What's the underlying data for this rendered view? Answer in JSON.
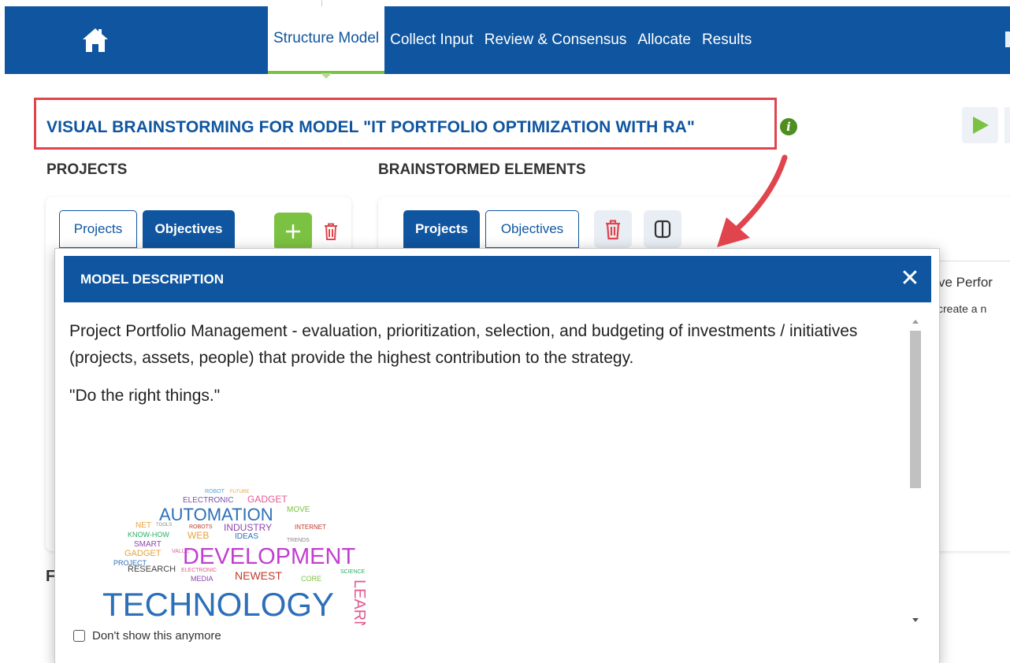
{
  "nav": {
    "home_icon": "home-icon",
    "tabs": [
      {
        "label": "Structure Model",
        "active": true
      },
      {
        "label": "Collect Input",
        "active": false
      },
      {
        "label": "Review & Consensus",
        "active": false
      },
      {
        "label": "Allocate",
        "active": false
      },
      {
        "label": "Results",
        "active": false
      }
    ]
  },
  "page": {
    "title": "VISUAL BRAINSTORMING FOR MODEL \"IT PORTFOLIO OPTIMIZATION WITH RA\"",
    "info_icon": "i"
  },
  "left_panel": {
    "heading": "PROJECTS",
    "tab_projects": "Projects",
    "tab_objectives": "Objectives",
    "add_label": "+"
  },
  "right_panel": {
    "heading": "BRAINSTORMED ELEMENTS",
    "tab_projects": "Projects",
    "tab_objectives": "Objectives",
    "peek_title": "ve Perfor",
    "peek_subtitle": "create a n"
  },
  "modal": {
    "title": "MODEL DESCRIPTION",
    "close_label": "✕",
    "paragraph_1": "Project Portfolio Management - evaluation, prioritization, selection, and budgeting of investments / initiatives (projects, assets, people) that provide the highest contribution to the strategy.",
    "paragraph_2": "\"Do the right things.\"",
    "checkbox_label": "Don't show this anymore",
    "checkbox_checked": false,
    "wordcloud_words": [
      "ROBOT",
      "FUTURE",
      "ELECTRONIC",
      "GADGET",
      "AUTOMATION",
      "MOVE",
      "NET",
      "TOOLS",
      "ROBOTS",
      "INDUSTRY",
      "INTERNET",
      "KNOW-HOW",
      "WEB",
      "IDEAS",
      "SMART",
      "VALUE",
      "TRENDS",
      "GADGET",
      "DEVELOPMENT",
      "PROJECT",
      "RESEARCH",
      "ELECTRONIC",
      "NEWEST",
      "SCIENCE",
      "MEDIA",
      "CORE",
      "TECHNOLOGY",
      "LEARN"
    ]
  },
  "bottom": {
    "cut_letter": "F"
  },
  "colors": {
    "brand_blue": "#0f559f",
    "accent_green": "#7cc242",
    "danger_red": "#e0454d",
    "info_green": "#4e8d1f"
  }
}
